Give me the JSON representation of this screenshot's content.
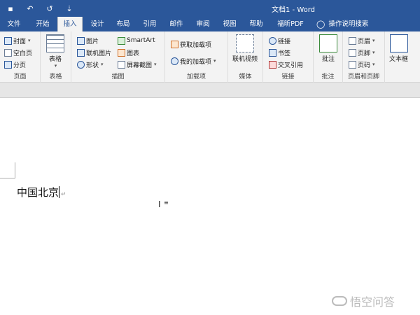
{
  "window": {
    "title": "文档1 - Word"
  },
  "qat": {
    "save": "▪",
    "undo": "↶",
    "redo": "↺",
    "more": "⇣"
  },
  "tabs": [
    {
      "label": "文件"
    },
    {
      "label": "开始"
    },
    {
      "label": "插入"
    },
    {
      "label": "设计"
    },
    {
      "label": "布局"
    },
    {
      "label": "引用"
    },
    {
      "label": "邮件"
    },
    {
      "label": "审阅"
    },
    {
      "label": "视图"
    },
    {
      "label": "帮助"
    },
    {
      "label": "福昕PDF"
    }
  ],
  "tell_me": {
    "label": "操作说明搜索",
    "icon": "lightbulb-icon"
  },
  "ribbon": {
    "pages": {
      "cover": "封面",
      "blank": "空白页",
      "break": "分页",
      "label": "页面"
    },
    "tables": {
      "table": "表格",
      "label": "表格"
    },
    "illustrations": {
      "pictures": "图片",
      "online_pictures": "联机图片",
      "shapes": "形状",
      "smartart": "SmartArt",
      "chart": "图表",
      "screenshot": "屏幕截图",
      "label": "插图"
    },
    "addins": {
      "get": "获取加载项",
      "my": "我的加载项",
      "label": "加载项"
    },
    "media": {
      "online_video": "联机视频",
      "label": "媒体"
    },
    "links": {
      "link": "链接",
      "bookmark": "书签",
      "cross_ref": "交叉引用",
      "label": "链接"
    },
    "comments": {
      "comment": "批注",
      "label": "批注"
    },
    "header_footer": {
      "header": "页眉",
      "footer": "页脚",
      "page_number": "页码",
      "label": "页眉和页脚"
    },
    "text": {
      "textbox": "文本框"
    }
  },
  "document": {
    "text": "中国北京",
    "para_mark": "↵"
  },
  "watermark": {
    "text": "悟空问答"
  }
}
